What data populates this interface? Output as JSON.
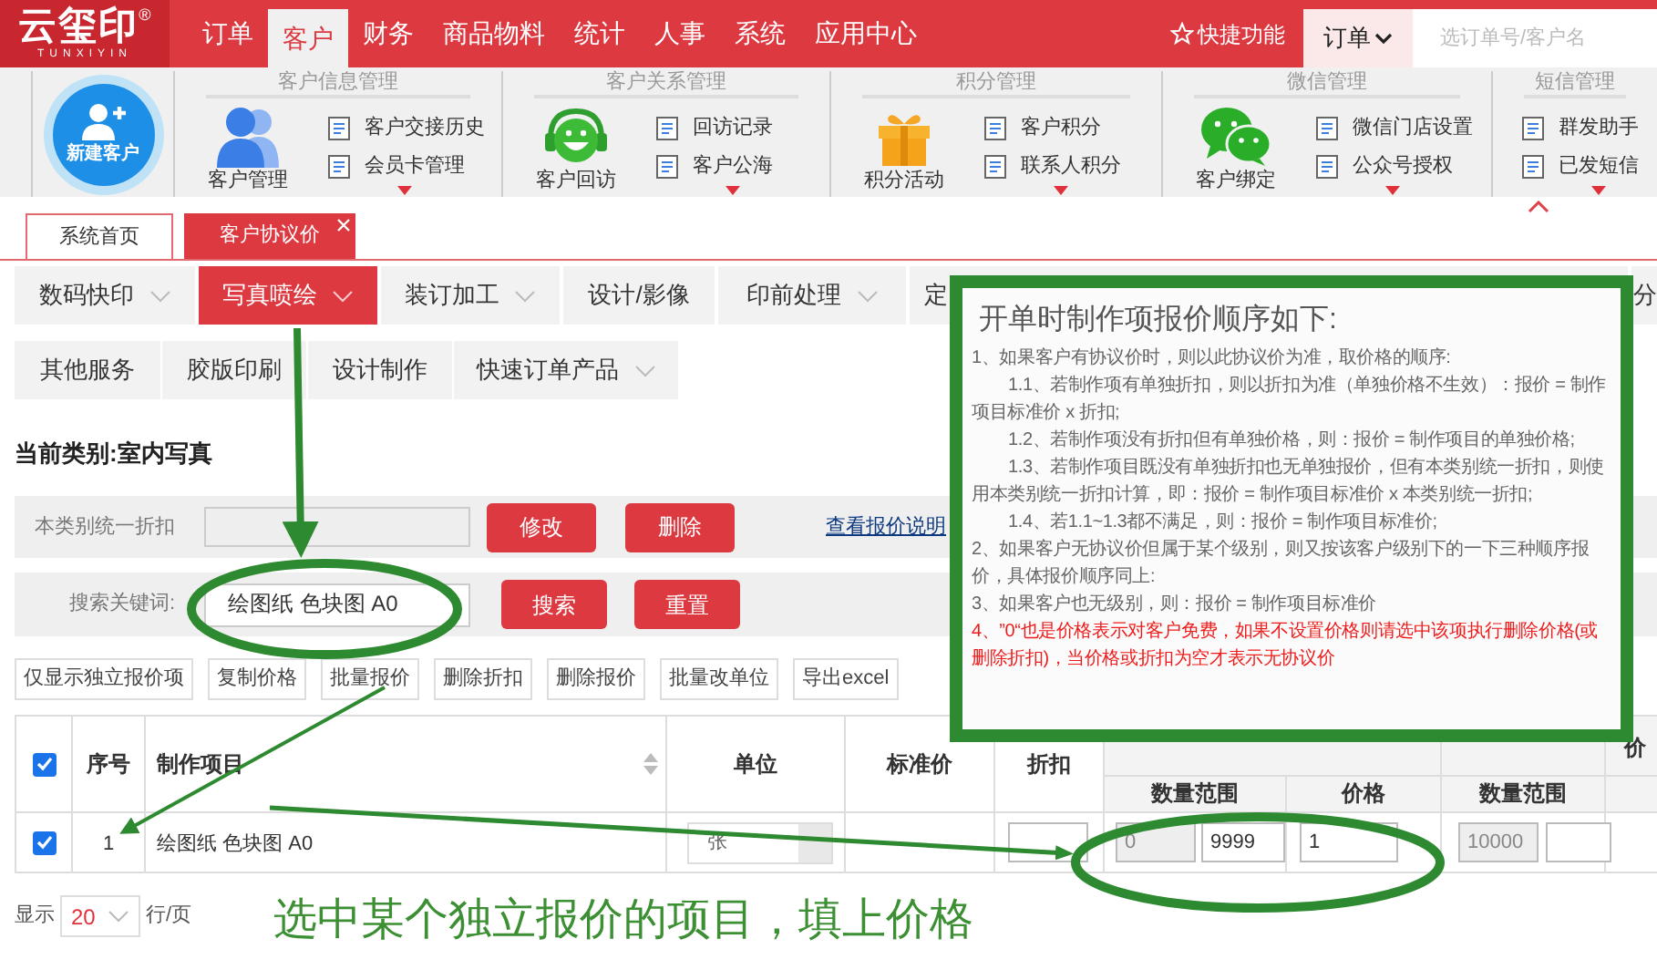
{
  "logo": {
    "name": "云玺印",
    "latin": "TUNXIYIN",
    "mark": "®"
  },
  "top_nav": [
    {
      "label": "订单",
      "selected": false
    },
    {
      "label": "客户",
      "selected": true
    },
    {
      "label": "财务",
      "selected": false
    },
    {
      "label": "商品物料",
      "selected": false
    },
    {
      "label": "统计",
      "selected": false
    },
    {
      "label": "人事",
      "selected": false
    },
    {
      "label": "系统",
      "selected": false
    },
    {
      "label": "应用中心",
      "selected": false
    }
  ],
  "shortcut": "快捷功能",
  "quick_search": {
    "scope": "订单",
    "placeholder": "选订单号/客户名"
  },
  "ribbon": {
    "new_customer": "新建客户",
    "groups": [
      {
        "title": "客户信息管理",
        "feature": {
          "label": "客户管理",
          "kind": "people"
        },
        "links": [
          "客户交接历史",
          "会员卡管理"
        ]
      },
      {
        "title": "客户关系管理",
        "feature": {
          "label": "客户回访",
          "kind": "headset"
        },
        "links": [
          "回访记录",
          "客户公海"
        ]
      },
      {
        "title": "积分管理",
        "feature": {
          "label": "积分活动",
          "kind": "gift"
        },
        "links": [
          "客户积分",
          "联系人积分"
        ]
      },
      {
        "title": "微信管理",
        "feature": {
          "label": "客户绑定",
          "kind": "chat"
        },
        "links": [
          "微信门店设置",
          "公众号授权"
        ]
      },
      {
        "title": "短信管理",
        "links": [
          "群发助手",
          "已发短信"
        ]
      }
    ]
  },
  "page_tabs": [
    {
      "label": "系统首页",
      "selected": false,
      "closable": false
    },
    {
      "label": "客户协议价",
      "selected": true,
      "closable": true
    }
  ],
  "categories": [
    [
      {
        "label": "数码快印",
        "selected": false,
        "dropdown": true
      },
      {
        "label": "写真喷绘",
        "selected": true,
        "dropdown": true
      },
      {
        "label": "装订加工",
        "selected": false,
        "dropdown": true
      },
      {
        "label": "设计/影像",
        "selected": false,
        "dropdown": false
      },
      {
        "label": "印前处理",
        "selected": false,
        "dropdown": true
      },
      {
        "label": "定",
        "selected": false,
        "dropdown": false
      },
      {
        "label": "分",
        "selected": false,
        "dropdown": false
      }
    ],
    [
      {
        "label": "其他服务",
        "selected": false,
        "dropdown": false
      },
      {
        "label": "胶版印刷",
        "selected": false,
        "dropdown": false
      },
      {
        "label": "设计制作",
        "selected": false,
        "dropdown": false
      },
      {
        "label": "快速订单产品",
        "selected": false,
        "dropdown": true
      }
    ]
  ],
  "current_category": "当前类别:室内写真",
  "discount_form": {
    "label": "本类别统一折扣",
    "buttons": [
      "修改",
      "删除"
    ],
    "link": "查看报价说明"
  },
  "search_form": {
    "label": "搜索关键词:",
    "value": "绘图纸 色块图 A0",
    "buttons": [
      "搜索",
      "重置"
    ]
  },
  "toolbar": [
    "仅显示独立报价项",
    "复制价格",
    "批量报价",
    "删除折扣",
    "删除报价",
    "批量改单位",
    "导出excel"
  ],
  "table": {
    "header_checked": true,
    "columns": [
      "序号",
      "制作项目",
      "单位",
      "标准价",
      "折扣"
    ],
    "sub_columns": [
      "数量范围",
      "价格",
      "数量范围"
    ],
    "column_cut": "价",
    "rows": [
      {
        "checked": true,
        "no": "1",
        "item": "绘图纸 色块图 A0",
        "unit": "张",
        "tier1_from": "0",
        "tier1_to": "9999",
        "tier1_price": "1",
        "tier2_from": "10000"
      }
    ]
  },
  "pagination": {
    "label_before": "显示",
    "page_size": "20",
    "label_after": "行/页"
  },
  "tooltip": {
    "title": "开单时制作项报价顺序如下:",
    "lines": [
      {
        "text": "1、如果客户有协议价时，则以此协议价为准，取价格的顺序:",
        "kind": "item"
      },
      {
        "text": "1.1、若制作项有单独折扣，则以折扣为准（单独价格不生效）：报价 = 制作项目标准价 x 折扣;",
        "kind": "subitem"
      },
      {
        "text": "1.2、若制作项没有折扣但有单独价格，则：报价 = 制作项目的单独价格;",
        "kind": "subitem"
      },
      {
        "text": "1.3、若制作项目既没有单独折扣也无单独报价，但有本类别统一折扣，则使用本类别统一折扣计算，即：报价 = 制作项目标准价 x 本类别统一折扣;",
        "kind": "subitem"
      },
      {
        "text": "1.4、若1.1~1.3都不满足，则：报价 = 制作项目标准价;",
        "kind": "subitem"
      },
      {
        "text": "2、如果客户无协议价但属于某个级别，则又按该客户级别下的一下三种顺序报价，具体报价顺序同上:",
        "kind": "item"
      },
      {
        "text": "3、如果客户也无级别，则：报价 = 制作项目标准价",
        "kind": "item"
      },
      {
        "text": "4、”0“也是价格表示对客户免费，如果不设置价格则请选中该项执行删除价格(或删除折扣)，当价格或折扣为空才表示无协议价",
        "kind": "warning"
      }
    ]
  },
  "annotation": "选中某个独立报价的项目，填上价格"
}
